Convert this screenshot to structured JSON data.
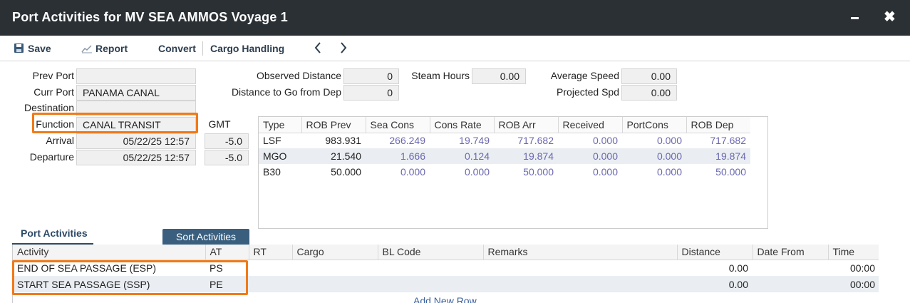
{
  "window": {
    "title": "Port Activities for MV SEA AMMOS Voyage 1"
  },
  "toolbar": {
    "save": "Save",
    "report": "Report",
    "convert": "Convert",
    "cargo_handling": "Cargo Handling"
  },
  "form": {
    "prev_port_label": "Prev Port",
    "prev_port_value": "",
    "curr_port_label": "Curr Port",
    "curr_port_value": "PANAMA CANAL",
    "destination_label": "Destination",
    "destination_value": "",
    "function_label": "Function",
    "function_value": "CANAL TRANSIT",
    "arrival_label": "Arrival",
    "arrival_value": "05/22/25 12:57",
    "departure_label": "Departure",
    "departure_value": "05/22/25 12:57",
    "gmt_label": "GMT",
    "arrival_gmt": "-5.0",
    "departure_gmt": "-5.0",
    "observed_distance_label": "Observed Distance",
    "observed_distance_value": "0",
    "dist_to_go_label": "Distance to Go from Dep",
    "dist_to_go_value": "0",
    "steam_hours_label": "Steam Hours",
    "steam_hours_value": "0.00",
    "avg_speed_label": "Average Speed",
    "avg_speed_value": "0.00",
    "projected_spd_label": "Projected Spd",
    "projected_spd_value": "0.00"
  },
  "rob_table": {
    "headers": [
      "Type",
      "ROB Prev",
      "Sea Cons",
      "Cons Rate",
      "ROB Arr",
      "Received",
      "PortCons",
      "ROB Dep"
    ],
    "rows": [
      [
        "LSF",
        "983.931",
        "266.249",
        "19.749",
        "717.682",
        "0.000",
        "0.000",
        "717.682"
      ],
      [
        "MGO",
        "21.540",
        "1.666",
        "0.124",
        "19.874",
        "0.000",
        "0.000",
        "19.874"
      ],
      [
        "B30",
        "50.000",
        "0.000",
        "0.000",
        "50.000",
        "0.000",
        "0.000",
        "50.000"
      ]
    ]
  },
  "activities": {
    "tab_label": "Port Activities",
    "sort_button": "Sort Activities",
    "headers": [
      "Activity",
      "AT",
      "RT",
      "Cargo",
      "BL Code",
      "Remarks",
      "Distance",
      "Date From",
      "Time"
    ],
    "rows": [
      [
        "END OF SEA PASSAGE (ESP)",
        "PS",
        "",
        "",
        "",
        "",
        "0.00",
        "",
        "00:00"
      ],
      [
        "START SEA PASSAGE (SSP)",
        "PE",
        "",
        "",
        "",
        "",
        "0.00",
        "",
        "00:00"
      ]
    ],
    "add_row": "Add New Row"
  },
  "colors": {
    "titlebar": "#2b3035",
    "highlight": "#f07a18",
    "accent": "#3a5f7e",
    "value_text": "#6b68b0"
  }
}
